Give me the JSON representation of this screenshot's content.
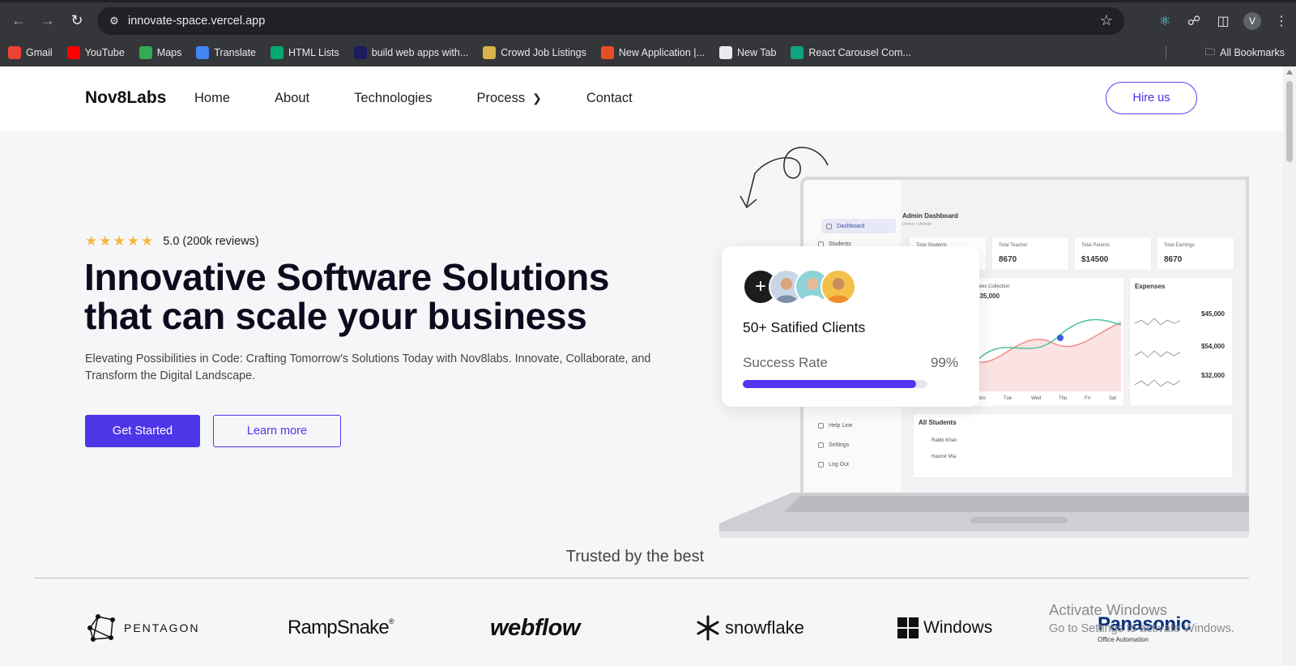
{
  "browser": {
    "url": "innovate-space.vercel.app",
    "avatar_letter": "V",
    "bookmarks": [
      {
        "label": "Gmail",
        "icon": "gmail-icon",
        "color": "#ea4335"
      },
      {
        "label": "YouTube",
        "icon": "youtube-icon",
        "color": "#ff0000"
      },
      {
        "label": "Maps",
        "icon": "maps-icon",
        "color": "#34a853"
      },
      {
        "label": "Translate",
        "icon": "translate-icon",
        "color": "#4285f4"
      },
      {
        "label": "HTML Lists",
        "icon": "w3schools-icon",
        "color": "#04aa6d"
      },
      {
        "label": "build web apps with...",
        "icon": "bubble-icon",
        "color": "#1b1b5e"
      },
      {
        "label": "Crowd Job Listings",
        "icon": "crowd-icon",
        "color": "#d9b24a"
      },
      {
        "label": "New Application |...",
        "icon": "application-icon",
        "color": "#e84d2a"
      },
      {
        "label": "New Tab",
        "icon": "globe-icon",
        "color": "#e8eaed"
      },
      {
        "label": "React Carousel Com...",
        "icon": "chatgpt-icon",
        "color": "#10a37f"
      }
    ],
    "all_bookmarks": "All Bookmarks"
  },
  "header": {
    "logo": "Nov8Labs",
    "nav": [
      "Home",
      "About",
      "Technologies",
      "Process",
      "Contact"
    ],
    "hire": "Hire us"
  },
  "hero": {
    "rating_text": "5.0 (200k reviews)",
    "stars": 5,
    "title_line1": "Innovative Software Solutions",
    "title_line2": "that can scale your business",
    "subtitle": "Elevating Possibilities in Code: Crafting Tomorrow's Solutions Today with Nov8labs. Innovate, Collaborate, and Transform the Digital Landscape.",
    "primary_cta": "Get Started",
    "secondary_cta": "Learn more"
  },
  "card": {
    "clients": "50+ Satified Clients",
    "success_label": "Success Rate",
    "success_value": "99%",
    "success_fraction": 0.94
  },
  "dashboard": {
    "title": "Admin Dashboard",
    "breadcrumb": "Home > Admin",
    "side": [
      "Dashboard",
      "Students",
      "Help Line",
      "Settings",
      "Log Out"
    ],
    "stats": [
      {
        "label": "Total Students",
        "value": ""
      },
      {
        "label": "Total Teacher",
        "value": "8670"
      },
      {
        "label": "Total Parents",
        "value": "$14500"
      },
      {
        "label": "Total Earnings",
        "value": "8670"
      }
    ],
    "fees_label": "Fees Collection",
    "fees_value": "$35,000",
    "days": [
      "Mon",
      "Tue",
      "Wed",
      "Thu",
      "Fri",
      "Sat"
    ],
    "expenses_title": "Expenses",
    "expenses": [
      "$45,000",
      "$54,000",
      "$32,000"
    ],
    "students_title": "All Students",
    "students": [
      "Rabbi Khan",
      "Hasmir Mia"
    ]
  },
  "trusted": {
    "heading": "Trusted by the best",
    "logos": [
      "PENTAGON",
      "RampSnake",
      "webflow",
      "snowflake",
      "Windows",
      "Panasonic"
    ],
    "panasonic_sub": "Office Automation"
  },
  "watermark": {
    "line1": "Activate Windows",
    "line2": "Go to Settings to activate Windows."
  }
}
